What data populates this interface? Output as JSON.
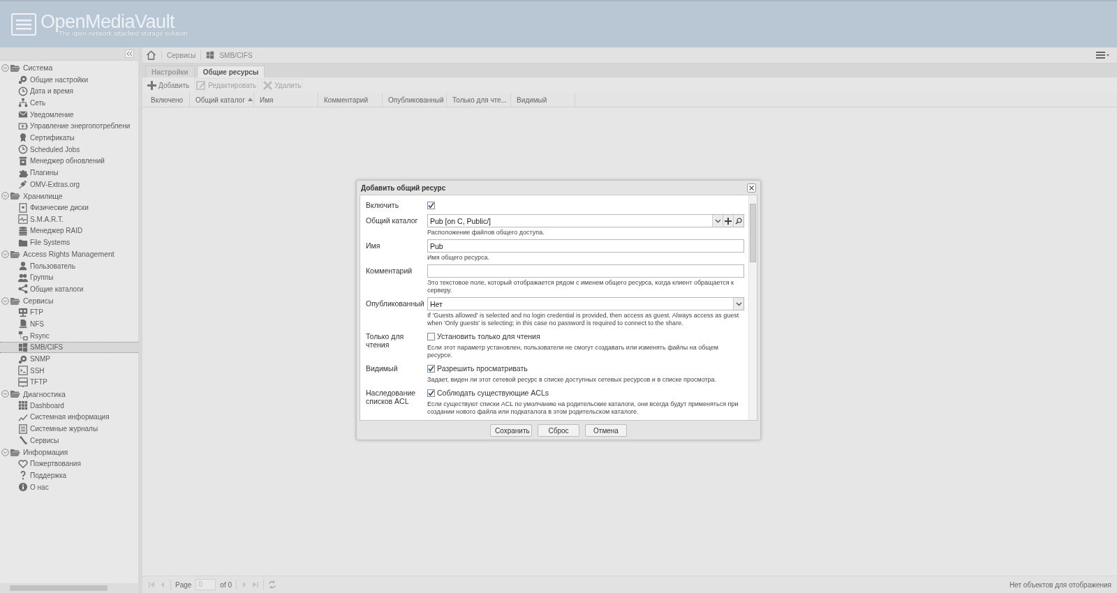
{
  "header": {
    "title": "OpenMediaVault",
    "subtitle": "The open network attached storage solution"
  },
  "sidebar": {
    "groups": [
      {
        "label": "Система",
        "expanded": true,
        "children": [
          {
            "label": "Общие настройки",
            "selected": false
          },
          {
            "label": "Дата и время",
            "selected": false
          },
          {
            "label": "Сеть",
            "selected": false
          },
          {
            "label": "Уведомление",
            "selected": false
          },
          {
            "label": "Управление энергопотреблени",
            "selected": false
          },
          {
            "label": "Сертификаты",
            "selected": false
          },
          {
            "label": "Scheduled Jobs",
            "selected": false
          },
          {
            "label": "Менеджер обновлений",
            "selected": false
          },
          {
            "label": "Плагины",
            "selected": false
          },
          {
            "label": "OMV-Extras.org",
            "selected": false
          }
        ]
      },
      {
        "label": "Хранилище",
        "expanded": true,
        "children": [
          {
            "label": "Физические диски",
            "selected": false
          },
          {
            "label": "S.M.A.R.T.",
            "selected": false
          },
          {
            "label": "Менеджер RAID",
            "selected": false
          },
          {
            "label": "File Systems",
            "selected": false
          }
        ]
      },
      {
        "label": "Access Rights Management",
        "expanded": true,
        "children": [
          {
            "label": "Пользователь",
            "selected": false
          },
          {
            "label": "Группы",
            "selected": false
          },
          {
            "label": "Общие каталоги",
            "selected": false
          }
        ]
      },
      {
        "label": "Сервисы",
        "expanded": true,
        "children": [
          {
            "label": "FTP",
            "selected": false
          },
          {
            "label": "NFS",
            "selected": false
          },
          {
            "label": "Rsync",
            "selected": false
          },
          {
            "label": "SMB/CIFS",
            "selected": true
          },
          {
            "label": "SNMP",
            "selected": false
          },
          {
            "label": "SSH",
            "selected": false
          },
          {
            "label": "TFTP",
            "selected": false
          }
        ]
      },
      {
        "label": "Диагностика",
        "expanded": true,
        "children": [
          {
            "label": "Dashboard",
            "selected": false
          },
          {
            "label": "Системная информация",
            "selected": false
          },
          {
            "label": "Системные журналы",
            "selected": false
          },
          {
            "label": "Сервисы",
            "selected": false
          }
        ]
      },
      {
        "label": "Информация",
        "expanded": true,
        "children": [
          {
            "label": "Пожертвования",
            "selected": false
          },
          {
            "label": "Поддержка",
            "selected": false
          },
          {
            "label": "О нас",
            "selected": false
          }
        ]
      }
    ]
  },
  "breadcrumb": [
    "Сервисы",
    "SMB/CIFS"
  ],
  "tabs": [
    {
      "label": "Настройки",
      "selected": false
    },
    {
      "label": "Общие ресурсы",
      "selected": true
    }
  ],
  "toolbar": [
    {
      "label": "Добавить",
      "disabled": false
    },
    {
      "label": "Редактировать",
      "disabled": true
    },
    {
      "label": "Удалить",
      "disabled": true
    }
  ],
  "table": {
    "columns": [
      {
        "label": "Включено"
      },
      {
        "label": "Общий каталог",
        "sorted": true
      },
      {
        "label": "Имя"
      },
      {
        "label": "Комментарий"
      },
      {
        "label": "Опубликованный"
      },
      {
        "label": "Только для чте..."
      },
      {
        "label": "Видимый"
      }
    ]
  },
  "pager": {
    "label": "Page",
    "page": "0",
    "of": "of 0",
    "status": "Нет объектов для отображения"
  },
  "dialog": {
    "title": "Добавить общий ресурс",
    "fields": [
      {
        "kind": "checkbox",
        "label": "Включить",
        "checked": true
      },
      {
        "kind": "combo",
        "label": "Общий каталог",
        "value": "Pub [on C, Public/]",
        "help": "Расположение файлов общего доступа."
      },
      {
        "kind": "text",
        "label": "Имя",
        "value": "Pub",
        "help": "Имя общего ресурса."
      },
      {
        "kind": "text",
        "label": "Комментарий",
        "help": "Это текстовое поле, который отображается рядом с именем общего ресурса, когда клиент обращается к серверу."
      },
      {
        "kind": "select",
        "label": "Опубликованный",
        "value": "Нет",
        "help": "If 'Guests allowed' is selected and no login credential is provided, then access as guest. Always access as guest when 'Only guests' is selecting; in this case no password is required to connect to the share."
      },
      {
        "kind": "checkbox",
        "label": "Только для чтения",
        "box_label": "Установить только для чтения",
        "checked": false,
        "help": "Если этот параметр установлен, пользователи не смогут создавать или изменять файлы на общем ресурсе."
      },
      {
        "kind": "checkbox",
        "label": "Видимый",
        "box_label": "Разрешить просматривать",
        "checked": true,
        "help": "Задает, виден ли этот сетевой ресурс в списке доступных сетевых ресурсов и в списке просмотра."
      },
      {
        "kind": "checkbox",
        "label": "Наследование списков ACL",
        "box_label": "Соблюдать существующие ACLs",
        "checked": true,
        "help": "Если существуют списки ACL по умолчанию на родительские каталоги, они всегда будут применяться при создании нового файла или подкаталога в этом родительском каталоге."
      }
    ],
    "buttons": [
      "Сохранить",
      "Сброс",
      "Отмена"
    ]
  }
}
